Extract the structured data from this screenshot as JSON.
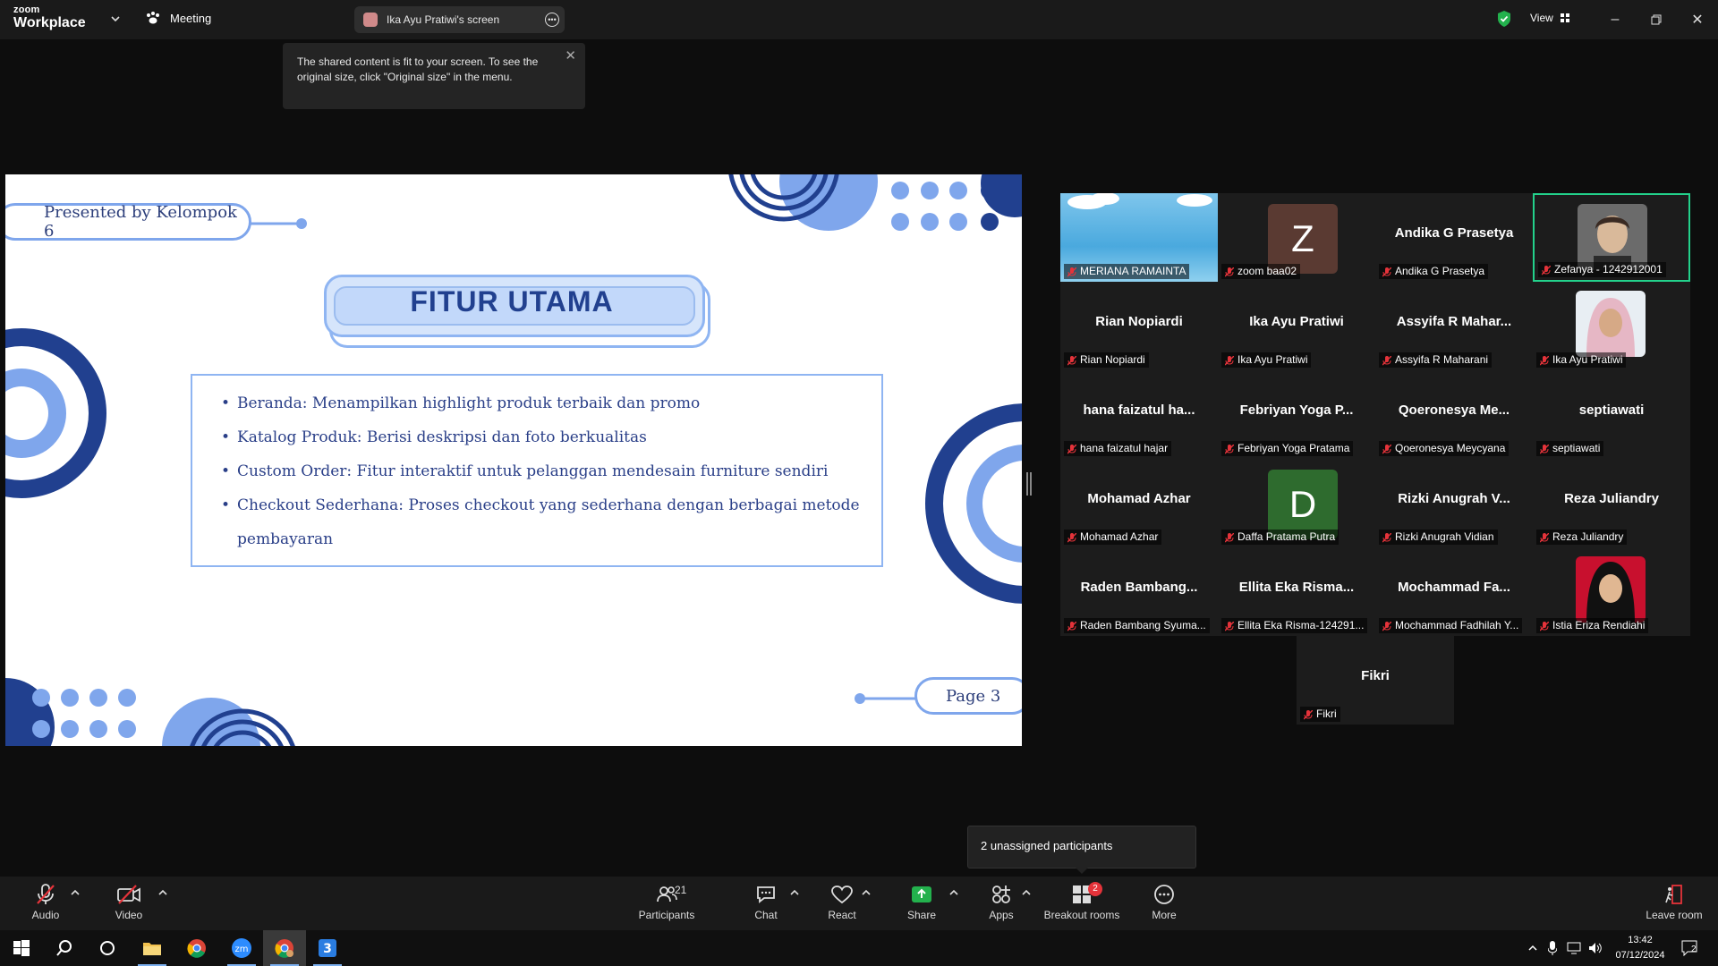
{
  "app": {
    "logo_line1": "zoom",
    "logo_line2": "Workplace"
  },
  "topbar": {
    "meeting_label": "Meeting",
    "screen_share_label": "Ika Ayu Pratiwi's screen",
    "view_label": "View"
  },
  "tooltip": {
    "text": "The shared content is fit to your screen. To see the original size, click \"Original size\" in the menu."
  },
  "slide": {
    "presented_by": "Presented by Kelompok 6",
    "title": "FITUR UTAMA",
    "bullets": [
      "Beranda: Menampilkan highlight produk terbaik dan promo",
      "Katalog Produk: Berisi deskripsi dan foto berkualitas",
      "Custom Order: Fitur interaktif untuk pelanggan mendesain furniture sendiri",
      "Checkout Sederhana: Proses checkout yang sederhana dengan berbagai metode",
      "pembayaran"
    ],
    "page_label": "Page 3",
    "colors": {
      "primary": "#1f3f8c",
      "accent": "#7fa6ec",
      "light": "#c2d8fa"
    }
  },
  "participants": [
    {
      "big": "",
      "label": "MERIANA RAMAINTA",
      "kind": "sky"
    },
    {
      "big": "",
      "label": "zoom baa02",
      "kind": "letter",
      "letter": "Z",
      "color": "#5a3a32"
    },
    {
      "big": "Andika G Prasetya",
      "label": "Andika G Prasetya",
      "kind": "name"
    },
    {
      "big": "",
      "label": "Zefanya - 1242912001",
      "kind": "photo-man",
      "active": true
    },
    {
      "big": "Rian Nopiardi",
      "label": "Rian Nopiardi",
      "kind": "name"
    },
    {
      "big": "Ika Ayu Pratiwi",
      "label": "Ika Ayu Pratiwi",
      "kind": "name"
    },
    {
      "big": "Assyifa R Mahar...",
      "label": "Assyifa R Maharani",
      "kind": "name"
    },
    {
      "big": "",
      "label": "Ika Ayu Pratiwi",
      "kind": "photo-hijab-light"
    },
    {
      "big": "hana faizatul ha...",
      "label": "hana faizatul hajar",
      "kind": "name"
    },
    {
      "big": "Febriyan Yoga P...",
      "label": "Febriyan Yoga Pratama",
      "kind": "name"
    },
    {
      "big": "Qoeronesya Me...",
      "label": "Qoeronesya Meycyana",
      "kind": "name"
    },
    {
      "big": "septiawati",
      "label": "septiawati",
      "kind": "name"
    },
    {
      "big": "Mohamad Azhar",
      "label": "Mohamad Azhar",
      "kind": "name"
    },
    {
      "big": "",
      "label": "Daffa Pratama Putra",
      "kind": "letter",
      "letter": "D",
      "color": "#2e6b2e"
    },
    {
      "big": "Rizki Anugrah V...",
      "label": "Rizki Anugrah Vidian",
      "kind": "name"
    },
    {
      "big": "Reza Juliandry",
      "label": "Reza Juliandry",
      "kind": "name"
    },
    {
      "big": "Raden Bambang...",
      "label": "Raden Bambang Syuma...",
      "kind": "name"
    },
    {
      "big": "Ellita Eka Risma...",
      "label": "Ellita Eka Risma-124291...",
      "kind": "name"
    },
    {
      "big": "Mochammad Fa...",
      "label": "Mochammad Fadhilah Y...",
      "kind": "name"
    },
    {
      "big": "",
      "label": "Istia Eriza Rendiahi",
      "kind": "photo-hijab-red"
    },
    {
      "big": "Fikri",
      "label": "Fikri",
      "kind": "name"
    }
  ],
  "unassigned": {
    "text": "2 unassigned participants"
  },
  "toolbar": {
    "audio": "Audio",
    "video": "Video",
    "participants": "Participants",
    "participants_count": "21",
    "chat": "Chat",
    "react": "React",
    "share": "Share",
    "apps": "Apps",
    "breakout": "Breakout rooms",
    "breakout_badge": "2",
    "more": "More",
    "leave": "Leave room"
  },
  "taskbar": {
    "time": "13:42",
    "date": "07/12/2024",
    "notifications": "2"
  }
}
